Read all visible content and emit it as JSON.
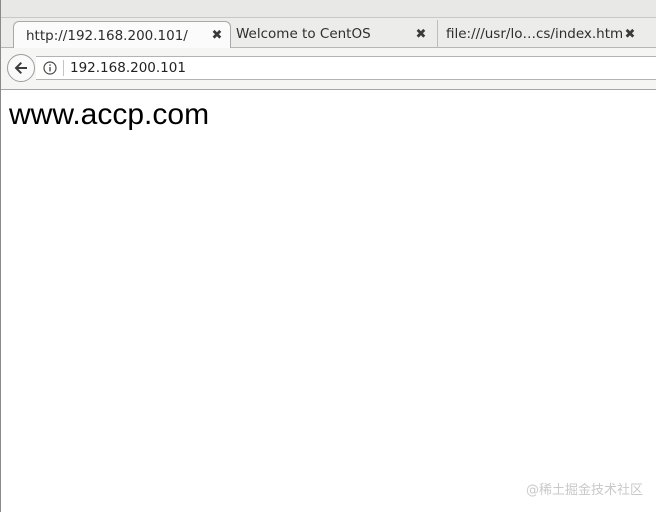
{
  "browser": {
    "tabs": [
      {
        "label": "http://192.168.200.101/",
        "active": true,
        "close_icon": "close-icon"
      },
      {
        "label": "Welcome to CentOS",
        "active": false,
        "close_icon": "close-icon"
      },
      {
        "label": "file:///usr/lo…cs/index.html",
        "active": false,
        "close_icon": "close-icon"
      }
    ],
    "close_glyph": "✖",
    "navigation": {
      "back_icon": "back-arrow-icon",
      "info_icon": "info-icon",
      "url": "192.168.200.101"
    }
  },
  "page": {
    "heading": "www.accp.com"
  },
  "watermark": {
    "text": "@稀土掘金技术社区"
  },
  "colors": {
    "tab_strip": "#ececeb",
    "active_tab": "#fbfbfb",
    "toolbar": "#f5f5f4",
    "page_background": "#ffffff"
  }
}
